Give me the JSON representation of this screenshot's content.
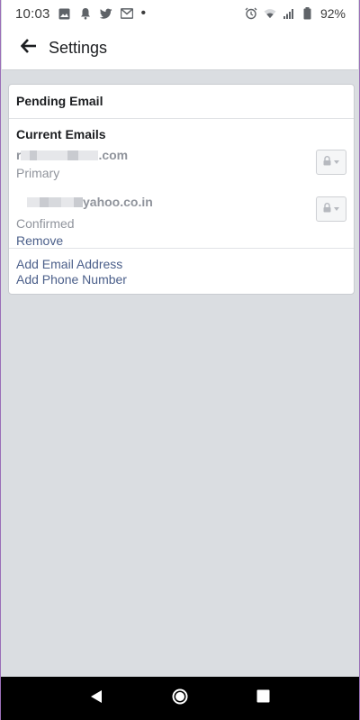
{
  "status_bar": {
    "time": "10:03",
    "battery": "92%",
    "left_icons": [
      "image-icon",
      "notification-bell-icon",
      "twitter-icon",
      "gmail-icon",
      "dot-icon"
    ],
    "right_icons": [
      "alarm-icon",
      "wifi-icon",
      "signal-icon",
      "battery-icon"
    ]
  },
  "header": {
    "title": "Settings",
    "back_icon": "back-arrow-icon"
  },
  "card": {
    "pending_title": "Pending Email",
    "current_title": "Current Emails",
    "emails": [
      {
        "prefix": "r",
        "suffix": ".com",
        "status": "Primary",
        "privacy_icon": "lock-icon"
      },
      {
        "prefix": "",
        "suffix": "yahoo.co.in",
        "status": "Confirmed",
        "action": "Remove",
        "privacy_icon": "lock-icon"
      }
    ],
    "add_email": "Add Email Address",
    "add_phone": "Add Phone Number"
  },
  "nav_bar": {
    "icons": [
      "back-triangle-icon",
      "home-circle-icon",
      "overview-square-icon"
    ]
  },
  "colors": {
    "link": "#4b5f8a",
    "muted_text": "#90949c",
    "background": "#dadde1",
    "frame_border": "#9b6fb8"
  }
}
